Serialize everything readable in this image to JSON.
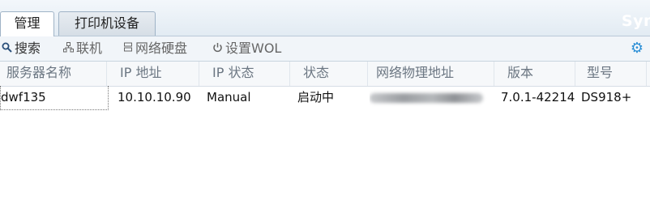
{
  "tabs": [
    {
      "label": "管理",
      "active": true
    },
    {
      "label": "打印机设备",
      "active": false
    }
  ],
  "brand": "Syn",
  "toolbar": {
    "search": {
      "label": "搜索",
      "icon": "search-icon"
    },
    "connect": {
      "label": "联机",
      "icon": "network-icon"
    },
    "map_drive": {
      "label": "网络硬盘",
      "icon": "drive-icon"
    },
    "wol": {
      "label": "设置WOL",
      "icon": "power-icon"
    },
    "settings_icon": "gear-icon"
  },
  "columns": [
    "服务器名称",
    "IP 地址",
    "IP 状态",
    "状态",
    "网络物理地址",
    "版本",
    "型号"
  ],
  "rows": [
    {
      "server_name": "dwf135",
      "ip_address": "10.10.10.90",
      "ip_status": "Manual",
      "status": "启动中",
      "mac_address": "",
      "version": "7.0.1-42214",
      "model": "DS918+"
    }
  ],
  "colors": {
    "accent": "#2b8fd6",
    "header_text": "#6b7682"
  }
}
